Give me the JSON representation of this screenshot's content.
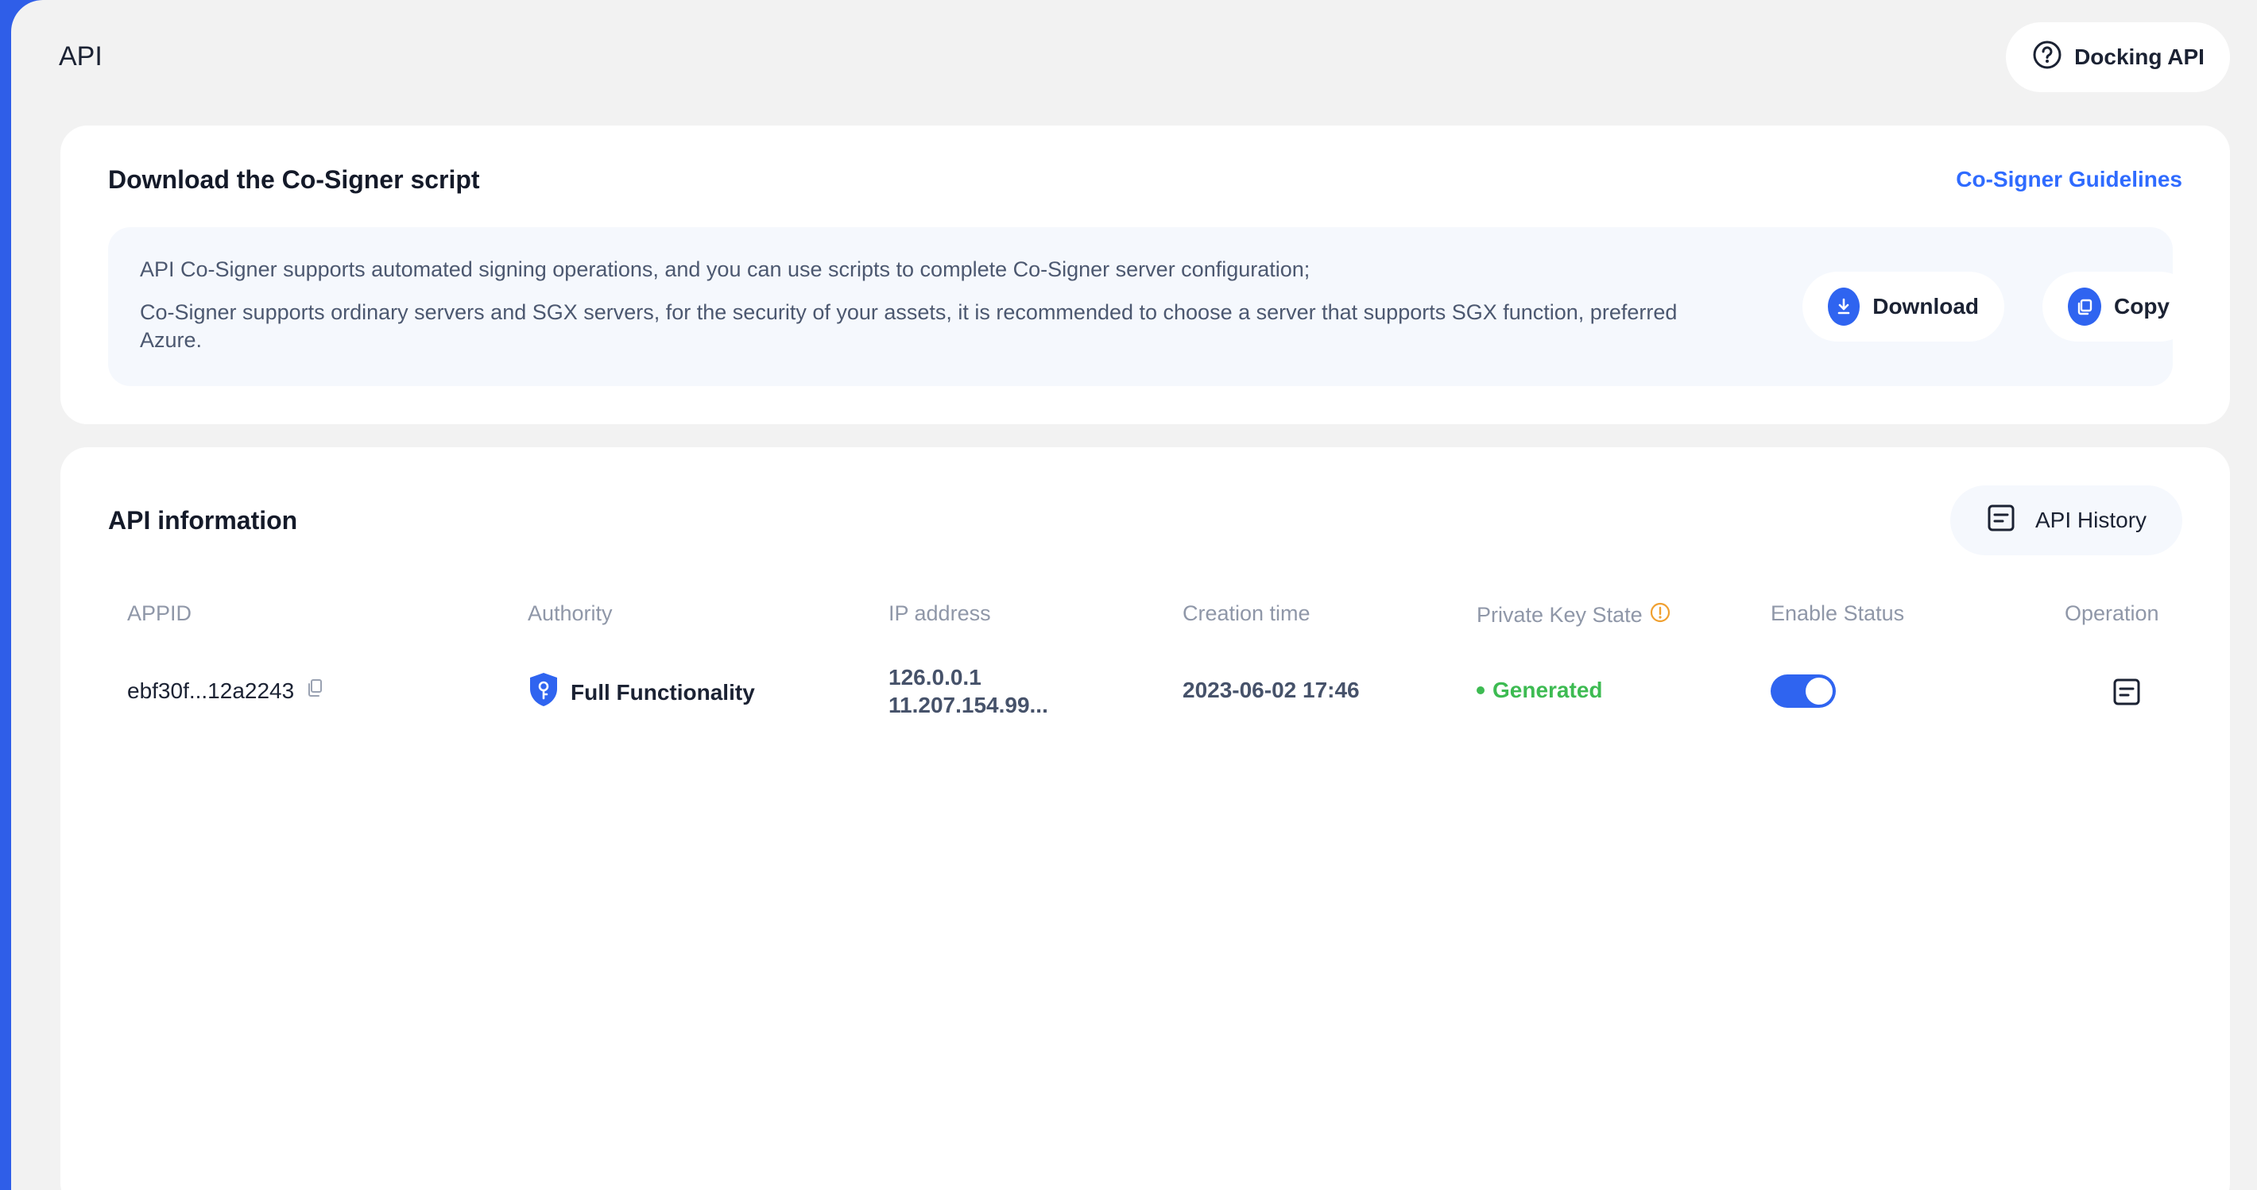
{
  "page": {
    "title": "API"
  },
  "header": {
    "docking_label": "Docking API"
  },
  "cosigner": {
    "title": "Download the Co-Signer script",
    "guidelines_link": "Co-Signer Guidelines",
    "line1": "API Co-Signer supports automated signing operations, and you can use scripts to complete Co-Signer server configuration;",
    "line2": "Co-Signer supports ordinary servers and SGX servers, for the security of your assets, it is recommended to choose a server that supports SGX function, preferred Azure.",
    "download_label": "Download",
    "copy_label": "Copy"
  },
  "api_info": {
    "title": "API information",
    "history_label": "API History",
    "columns": [
      "APPID",
      "Authority",
      "IP address",
      "Creation time",
      "Private Key State",
      "Enable Status",
      "Operation"
    ],
    "rows": [
      {
        "appid": "ebf30f...12a2243",
        "authority": "Full Functionality",
        "ip_line1": "126.0.0.1",
        "ip_line2": "11.207.154.99...",
        "creation_time": "2023-06-02 17:46",
        "private_key_state": "Generated",
        "enabled": true
      }
    ]
  },
  "colors": {
    "accent": "#2f64f0",
    "link": "#2f6bff",
    "success": "#3dbb52",
    "warning": "#f0a030",
    "background": "#f2f2f2"
  },
  "icons": [
    "question-circle-icon",
    "download-icon",
    "copy-icon",
    "document-list-icon",
    "shield-key-icon",
    "info-circle-icon"
  ]
}
